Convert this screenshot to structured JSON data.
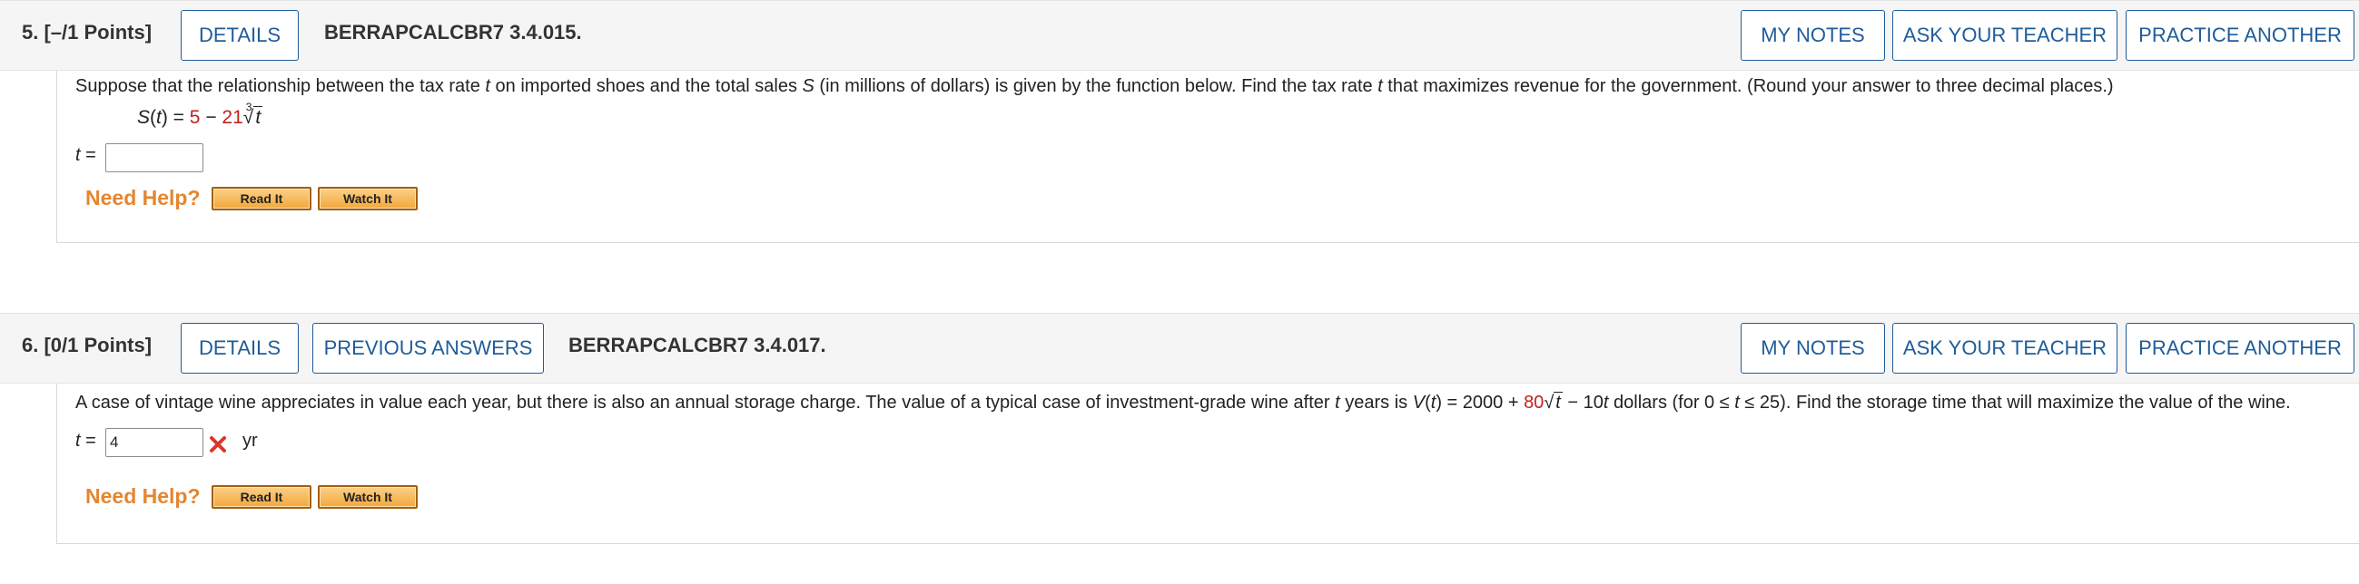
{
  "questions": [
    {
      "number": "5.",
      "points": "[–/1 Points]",
      "details_label": "DETAILS",
      "code": "BERRAPCALCBR7 3.4.015.",
      "my_notes_label": "MY NOTES",
      "ask_teacher_label": "ASK YOUR TEACHER",
      "practice_label": "PRACTICE ANOTHER",
      "prompt": "Suppose that the relationship between the tax rate t on imported shoes and the total sales S (in millions of dollars) is given by the function below. Find the tax rate t that maximizes revenue for the government. (Round your answer to three decimal places.)",
      "formula": {
        "lhs": "S(t) = ",
        "const": "5",
        "minus": " − ",
        "coef": "21",
        "root_index": "3",
        "radicand": "t"
      },
      "answer_var": "t",
      "answer_eq": " = ",
      "answer_value": "",
      "need_help": "Need Help?",
      "read_it": "Read It",
      "watch_it": "Watch It"
    },
    {
      "number": "6.",
      "points": "[0/1 Points]",
      "details_label": "DETAILS",
      "previous_answers_label": "PREVIOUS ANSWERS",
      "code": "BERRAPCALCBR7 3.4.017.",
      "my_notes_label": "MY NOTES",
      "ask_teacher_label": "ASK YOUR TEACHER",
      "practice_label": "PRACTICE ANOTHER",
      "prompt_a": "A case of vintage wine appreciates in value each year, but there is also an annual storage charge. The value of a typical case of investment-grade wine after ",
      "prompt_t1": "t",
      "prompt_b": " years is ",
      "prompt_V": "V",
      "prompt_c": "(",
      "prompt_t2": "t",
      "prompt_d": ") = 2000 + ",
      "prompt_coef": "80",
      "prompt_radicand": "t",
      "prompt_e": " − 10",
      "prompt_t3": "t",
      "prompt_f": " dollars (for 0 ≤ ",
      "prompt_t4": "t",
      "prompt_g": " ≤ 25). Find the storage time that will maximize the value of the wine.",
      "answer_var": "t",
      "answer_eq": " = ",
      "answer_value": "4",
      "answer_status_icon": "wrong-x-icon",
      "answer_unit": "yr",
      "need_help": "Need Help?",
      "read_it": "Read It",
      "watch_it": "Watch It"
    }
  ],
  "colors": {
    "link_blue": "#1f5c99",
    "help_orange": "#e5862f",
    "formula_red": "#c0221b",
    "wrong_red": "#d9372b"
  }
}
